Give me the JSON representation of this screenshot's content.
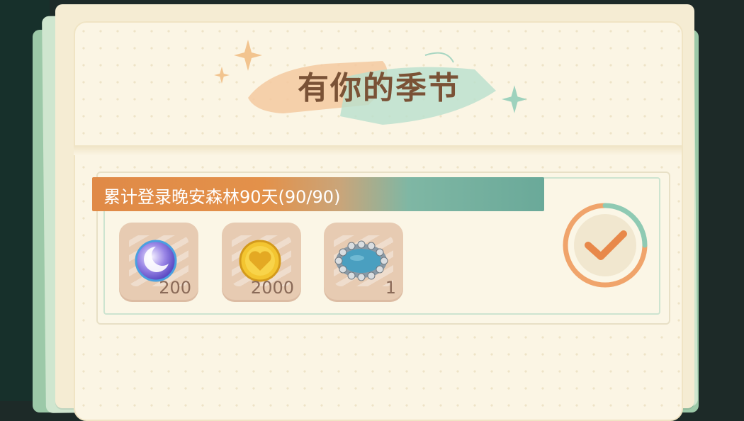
{
  "panel": {
    "title": "有你的季节"
  },
  "task": {
    "text": "累计登录晚安森林90天(90/90)",
    "progress_current": 90,
    "progress_total": 90,
    "completed": true
  },
  "rewards": [
    {
      "icon": "moon-crystal-icon",
      "count": "200"
    },
    {
      "icon": "gold-heart-coin-icon",
      "count": "2000"
    },
    {
      "icon": "stone-pond-icon",
      "count": "1"
    }
  ],
  "colors": {
    "task_bar_start": "#e08a47",
    "task_bar_end": "#6aa999",
    "title": "#7a5236",
    "check": "#e8884a"
  }
}
